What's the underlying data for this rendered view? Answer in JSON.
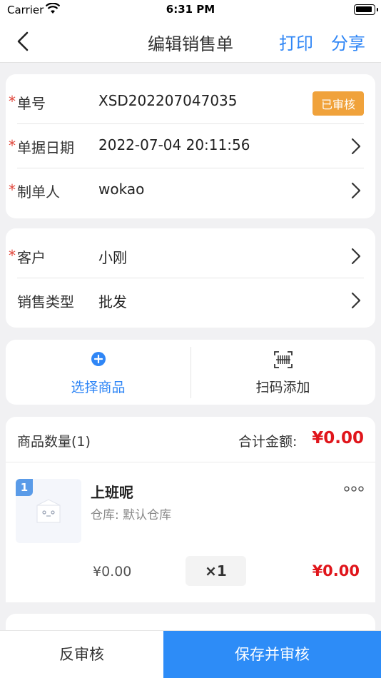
{
  "status_bar": {
    "carrier": "Carrier",
    "time": "6:31 PM"
  },
  "nav": {
    "title": "编辑销售单",
    "print": "打印",
    "share": "分享"
  },
  "order_info": {
    "number_label": "单号",
    "number_value": "XSD202207047035",
    "status_badge": "已审核",
    "date_label": "单据日期",
    "date_value": "2022-07-04 20:11:56",
    "maker_label": "制单人",
    "maker_value": "wokao"
  },
  "customer_info": {
    "customer_label": "客户",
    "customer_value": "小刚",
    "type_label": "销售类型",
    "type_value": "批发"
  },
  "actions": {
    "select_goods": "选择商品",
    "scan_add": "扫码添加"
  },
  "goods": {
    "count_label": "商品数量(1)",
    "total_label": "合计金额:",
    "total_value": "¥0.00",
    "items": [
      {
        "index": "1",
        "name": "上班呢",
        "warehouse": "仓库: 默认仓库",
        "price": "¥0.00",
        "qty": "×1",
        "subtotal": "¥0.00"
      }
    ]
  },
  "bottom": {
    "unaudit": "反审核",
    "save_audit": "保存并审核"
  },
  "colors": {
    "accent": "#2f86f6",
    "danger": "#e0151b",
    "badge": "#f0a23b",
    "required": "#e0453a"
  }
}
